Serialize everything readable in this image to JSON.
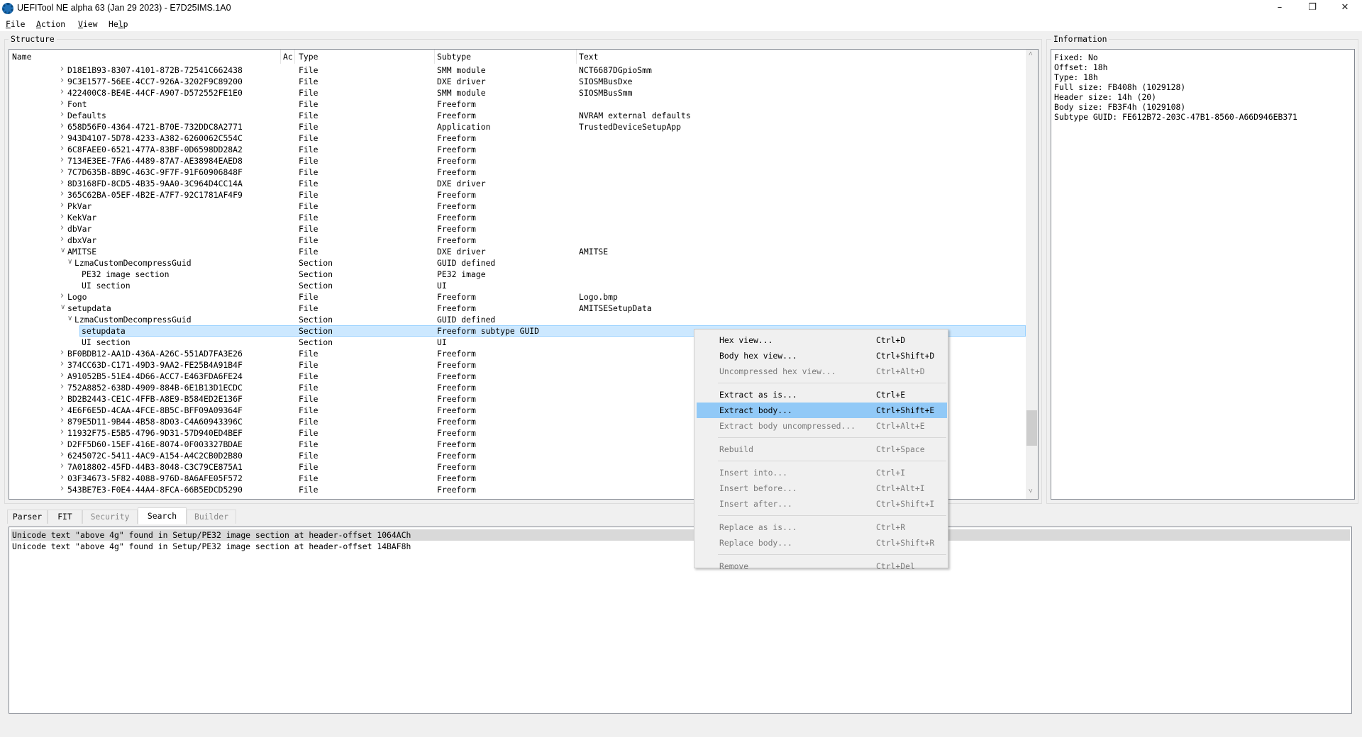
{
  "window": {
    "title": "UEFITool NE alpha 63 (Jan 29 2023) - E7D25IMS.1A0",
    "controls": [
      "minimize",
      "restore",
      "close"
    ]
  },
  "menubar": [
    {
      "label": "File",
      "u": "F",
      "rest": "ile"
    },
    {
      "label": "Action",
      "u": "A",
      "rest": "ction"
    },
    {
      "label": "View",
      "u": "V",
      "rest": "iew"
    },
    {
      "label": "Help",
      "pre": "He",
      "u": "l",
      "rest": "p"
    }
  ],
  "structure": {
    "title": "Structure",
    "columns": [
      "Name",
      "Ac",
      "Type",
      "Subtype",
      "Text"
    ],
    "rows": [
      {
        "level": 1,
        "exp": "c",
        "name": "D18E1B93-8307-4101-872B-72541C662438",
        "type": "File",
        "subtype": "SMM module",
        "text": "NCT6687DGpioSmm"
      },
      {
        "level": 1,
        "exp": "c",
        "name": "9C3E1577-56EE-4CC7-926A-3202F9C89200",
        "type": "File",
        "subtype": "DXE driver",
        "text": "SIOSMBusDxe"
      },
      {
        "level": 1,
        "exp": "c",
        "name": "422400C8-BE4E-44CF-A907-D572552FE1E0",
        "type": "File",
        "subtype": "SMM module",
        "text": "SIOSMBusSmm"
      },
      {
        "level": 1,
        "exp": "c",
        "name": "Font",
        "type": "File",
        "subtype": "Freeform",
        "text": ""
      },
      {
        "level": 1,
        "exp": "c",
        "name": "Defaults",
        "type": "File",
        "subtype": "Freeform",
        "text": "NVRAM external defaults"
      },
      {
        "level": 1,
        "exp": "c",
        "name": "658D56F0-4364-4721-B70E-732DDC8A2771",
        "type": "File",
        "subtype": "Application",
        "text": "TrustedDeviceSetupApp"
      },
      {
        "level": 1,
        "exp": "c",
        "name": "943D4107-5D78-4233-A382-6260062C554C",
        "type": "File",
        "subtype": "Freeform",
        "text": ""
      },
      {
        "level": 1,
        "exp": "c",
        "name": "6C8FAEE0-6521-477A-83BF-0D6598DD28A2",
        "type": "File",
        "subtype": "Freeform",
        "text": ""
      },
      {
        "level": 1,
        "exp": "c",
        "name": "7134E3EE-7FA6-4489-87A7-AE38984EAED8",
        "type": "File",
        "subtype": "Freeform",
        "text": ""
      },
      {
        "level": 1,
        "exp": "c",
        "name": "7C7D635B-8B9C-463C-9F7F-91F60906848F",
        "type": "File",
        "subtype": "Freeform",
        "text": ""
      },
      {
        "level": 1,
        "exp": "c",
        "name": "8D3168FD-8CD5-4B35-9AA0-3C964D4CC14A",
        "type": "File",
        "subtype": "DXE driver",
        "text": ""
      },
      {
        "level": 1,
        "exp": "c",
        "name": "365C62BA-05EF-4B2E-A7F7-92C1781AF4F9",
        "type": "File",
        "subtype": "Freeform",
        "text": ""
      },
      {
        "level": 1,
        "exp": "c",
        "name": "PkVar",
        "type": "File",
        "subtype": "Freeform",
        "text": ""
      },
      {
        "level": 1,
        "exp": "c",
        "name": "KekVar",
        "type": "File",
        "subtype": "Freeform",
        "text": ""
      },
      {
        "level": 1,
        "exp": "c",
        "name": "dbVar",
        "type": "File",
        "subtype": "Freeform",
        "text": ""
      },
      {
        "level": 1,
        "exp": "c",
        "name": "dbxVar",
        "type": "File",
        "subtype": "Freeform",
        "text": ""
      },
      {
        "level": 1,
        "exp": "e",
        "name": "AMITSE",
        "type": "File",
        "subtype": "DXE driver",
        "text": "AMITSE"
      },
      {
        "level": 2,
        "exp": "e",
        "name": "LzmaCustomDecompressGuid",
        "type": "Section",
        "subtype": "GUID defined",
        "text": ""
      },
      {
        "level": 3,
        "exp": "",
        "name": "PE32 image section",
        "type": "Section",
        "subtype": "PE32 image",
        "text": ""
      },
      {
        "level": 3,
        "exp": "",
        "name": "UI section",
        "type": "Section",
        "subtype": "UI",
        "text": ""
      },
      {
        "level": 1,
        "exp": "c",
        "name": "Logo",
        "type": "File",
        "subtype": "Freeform",
        "text": "Logo.bmp"
      },
      {
        "level": 1,
        "exp": "e",
        "name": "setupdata",
        "type": "File",
        "subtype": "Freeform",
        "text": "AMITSESetupData"
      },
      {
        "level": 2,
        "exp": "e",
        "name": "LzmaCustomDecompressGuid",
        "type": "Section",
        "subtype": "GUID defined",
        "text": ""
      },
      {
        "level": 3,
        "exp": "",
        "name": "setupdata",
        "type": "Section",
        "subtype": "Freeform subtype GUID",
        "text": "",
        "selected": true
      },
      {
        "level": 3,
        "exp": "",
        "name": "UI section",
        "type": "Section",
        "subtype": "UI",
        "text": ""
      },
      {
        "level": 1,
        "exp": "c",
        "name": "BF0BDB12-AA1D-436A-A26C-551AD7FA3E26",
        "type": "File",
        "subtype": "Freeform",
        "text": ""
      },
      {
        "level": 1,
        "exp": "c",
        "name": "374CC63D-C171-49D3-9AA2-FE25B4A91B4F",
        "type": "File",
        "subtype": "Freeform",
        "text": ""
      },
      {
        "level": 1,
        "exp": "c",
        "name": "A91052B5-51E4-4D66-ACC7-E463FDA6FE24",
        "type": "File",
        "subtype": "Freeform",
        "text": ""
      },
      {
        "level": 1,
        "exp": "c",
        "name": "752A8852-638D-4909-884B-6E1B13D1ECDC",
        "type": "File",
        "subtype": "Freeform",
        "text": ""
      },
      {
        "level": 1,
        "exp": "c",
        "name": "BD2B2443-CE1C-4FFB-A8E9-B584ED2E136F",
        "type": "File",
        "subtype": "Freeform",
        "text": ""
      },
      {
        "level": 1,
        "exp": "c",
        "name": "4E6F6E5D-4CAA-4FCE-8B5C-BFF09A09364F",
        "type": "File",
        "subtype": "Freeform",
        "text": ""
      },
      {
        "level": 1,
        "exp": "c",
        "name": "879E5D11-9B44-4B58-8D03-C4A60943396C",
        "type": "File",
        "subtype": "Freeform",
        "text": ""
      },
      {
        "level": 1,
        "exp": "c",
        "name": "11932F75-E5B5-4796-9D31-57D940ED4BEF",
        "type": "File",
        "subtype": "Freeform",
        "text": ""
      },
      {
        "level": 1,
        "exp": "c",
        "name": "D2FF5D60-15EF-416E-8074-0F003327BDAE",
        "type": "File",
        "subtype": "Freeform",
        "text": ""
      },
      {
        "level": 1,
        "exp": "c",
        "name": "6245072C-5411-4AC9-A154-A4C2CB0D2B80",
        "type": "File",
        "subtype": "Freeform",
        "text": ""
      },
      {
        "level": 1,
        "exp": "c",
        "name": "7A018802-45FD-44B3-8048-C3C79CE875A1",
        "type": "File",
        "subtype": "Freeform",
        "text": ""
      },
      {
        "level": 1,
        "exp": "c",
        "name": "03F34673-5F82-4088-976D-8A6AFE05F572",
        "type": "File",
        "subtype": "Freeform",
        "text": ""
      },
      {
        "level": 1,
        "exp": "c",
        "name": "543BE7E3-F0E4-44A4-8FCA-66B5EDCD5290",
        "type": "File",
        "subtype": "Freeform",
        "text": ""
      }
    ]
  },
  "information": {
    "title": "Information",
    "lines": [
      "Fixed: No",
      "Offset: 18h",
      "Type: 18h",
      "Full size: FB408h (1029128)",
      "Header size: 14h (20)",
      "Body size: FB3F4h (1029108)",
      "Subtype GUID: FE612B72-203C-47B1-8560-A66D946EB371"
    ]
  },
  "tabs": [
    {
      "label": "Parser",
      "state": "normal"
    },
    {
      "label": "FIT",
      "state": "normal"
    },
    {
      "label": "Security",
      "state": "disabled"
    },
    {
      "label": "Search",
      "state": "active"
    },
    {
      "label": "Builder",
      "state": "disabled"
    }
  ],
  "search_results": [
    "Unicode text \"above 4g\" found in Setup/PE32 image section at header-offset 1064ACh",
    "Unicode text \"above 4g\" found in Setup/PE32 image section at header-offset 14BAF8h"
  ],
  "context_menu": [
    {
      "label": "Hex view...",
      "shortcut": "Ctrl+D",
      "enabled": true
    },
    {
      "label": "Body hex view...",
      "shortcut": "Ctrl+Shift+D",
      "enabled": true
    },
    {
      "label": "Uncompressed hex view...",
      "shortcut": "Ctrl+Alt+D",
      "enabled": false
    },
    {
      "sep": true
    },
    {
      "label": "Extract as is...",
      "shortcut": "Ctrl+E",
      "enabled": true
    },
    {
      "label": "Extract body...",
      "shortcut": "Ctrl+Shift+E",
      "enabled": true,
      "highlighted": true
    },
    {
      "label": "Extract body uncompressed...",
      "shortcut": "Ctrl+Alt+E",
      "enabled": false
    },
    {
      "sep": true
    },
    {
      "label": "Rebuild",
      "shortcut": "Ctrl+Space",
      "enabled": false
    },
    {
      "sep": true
    },
    {
      "label": "Insert into...",
      "shortcut": "Ctrl+I",
      "enabled": false
    },
    {
      "label": "Insert before...",
      "shortcut": "Ctrl+Alt+I",
      "enabled": false
    },
    {
      "label": "Insert after...",
      "shortcut": "Ctrl+Shift+I",
      "enabled": false
    },
    {
      "sep": true
    },
    {
      "label": "Replace as is...",
      "shortcut": "Ctrl+R",
      "enabled": false
    },
    {
      "label": "Replace body...",
      "shortcut": "Ctrl+Shift+R",
      "enabled": false
    },
    {
      "sep": true
    },
    {
      "label": "Remove",
      "shortcut": "Ctrl+Del",
      "enabled": false
    }
  ],
  "colors": {
    "selection": "#cce8ff",
    "menu_highlight": "#91c9f7",
    "disabled_text": "#7a7a7a"
  }
}
